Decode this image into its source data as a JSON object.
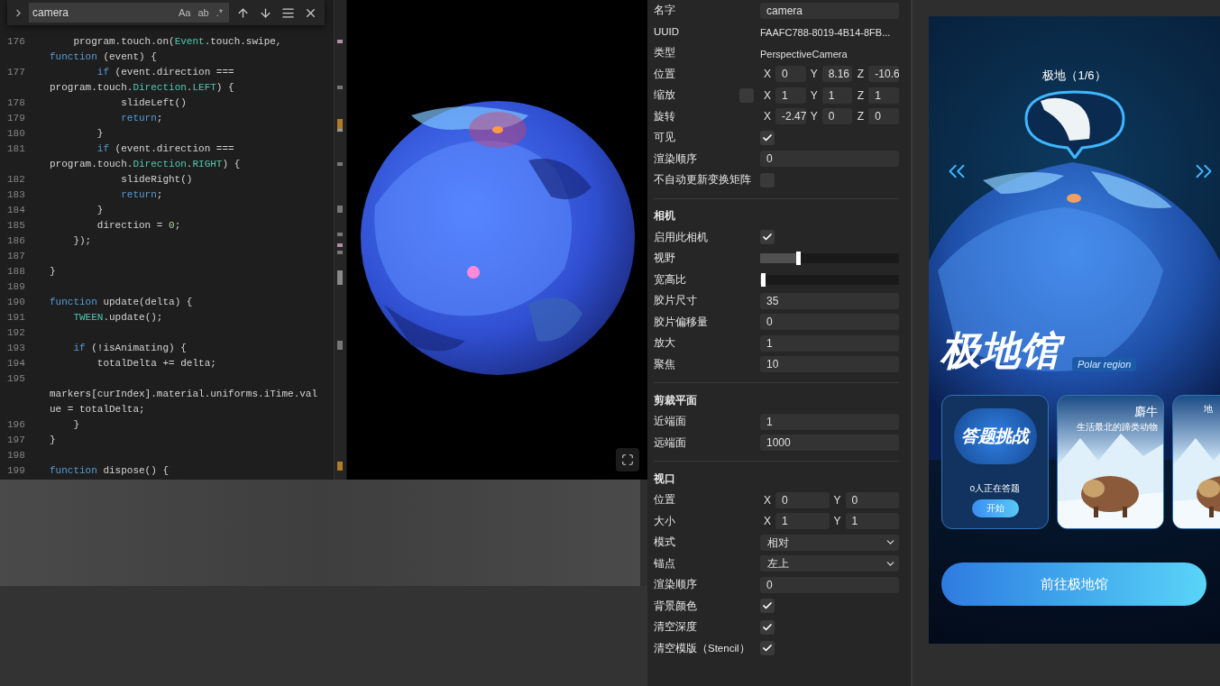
{
  "editor": {
    "search": {
      "value": "camera",
      "options": [
        {
          "label": "Aa",
          "selected": false
        },
        {
          "label": "ab",
          "selected": false
        },
        {
          "label": ".*",
          "selected": false
        }
      ]
    },
    "lines": [
      {
        "num": "176",
        "segs": [
          {
            "kind": "plain",
            "text": "    program.touch.on("
          },
          {
            "kind": "type",
            "text": "Event"
          },
          {
            "kind": "plain",
            "text": ".touch.swipe,"
          }
        ]
      },
      {
        "segs": [
          {
            "kind": "kw",
            "text": "function"
          },
          {
            "kind": "plain",
            "text": " (event) {"
          }
        ]
      },
      {
        "num": "177",
        "segs": [
          {
            "kind": "kw",
            "text": "        if"
          },
          {
            "kind": "plain",
            "text": " (event.direction ==="
          }
        ]
      },
      {
        "segs": [
          {
            "kind": "plain",
            "text": "program.touch."
          },
          {
            "kind": "type",
            "text": "Direction"
          },
          {
            "kind": "plain",
            "text": "."
          },
          {
            "kind": "type",
            "text": "LEFT"
          },
          {
            "kind": "plain",
            "text": ") {"
          }
        ]
      },
      {
        "num": "178",
        "segs": [
          {
            "kind": "plain",
            "text": "            slideLeft()"
          }
        ]
      },
      {
        "num": "179",
        "segs": [
          {
            "kind": "kw",
            "text": "            return"
          },
          {
            "kind": "plain",
            "text": ";"
          }
        ]
      },
      {
        "num": "180",
        "segs": [
          {
            "kind": "plain",
            "text": "        }"
          }
        ]
      },
      {
        "num": "181",
        "segs": [
          {
            "kind": "kw",
            "text": "        if"
          },
          {
            "kind": "plain",
            "text": " (event.direction ==="
          }
        ]
      },
      {
        "segs": [
          {
            "kind": "plain",
            "text": "program.touch."
          },
          {
            "kind": "type",
            "text": "Direction"
          },
          {
            "kind": "plain",
            "text": "."
          },
          {
            "kind": "type",
            "text": "RIGHT"
          },
          {
            "kind": "plain",
            "text": ") {"
          }
        ]
      },
      {
        "num": "182",
        "segs": [
          {
            "kind": "plain",
            "text": "            slideRight()"
          }
        ]
      },
      {
        "num": "183",
        "segs": [
          {
            "kind": "kw",
            "text": "            return"
          },
          {
            "kind": "plain",
            "text": ";"
          }
        ]
      },
      {
        "num": "184",
        "segs": [
          {
            "kind": "plain",
            "text": "        }"
          }
        ]
      },
      {
        "num": "185",
        "segs": [
          {
            "kind": "plain",
            "text": "        direction = "
          },
          {
            "kind": "num",
            "text": "0"
          },
          {
            "kind": "plain",
            "text": ";"
          }
        ]
      },
      {
        "num": "186",
        "segs": [
          {
            "kind": "plain",
            "text": "    });"
          }
        ]
      },
      {
        "num": "187"
      },
      {
        "num": "188",
        "segs": [
          {
            "kind": "plain",
            "text": "}"
          }
        ]
      },
      {
        "num": "189"
      },
      {
        "num": "190",
        "segs": [
          {
            "kind": "kw",
            "text": "function"
          },
          {
            "kind": "plain",
            "text": " update(delta) {"
          }
        ]
      },
      {
        "num": "191",
        "segs": [
          {
            "kind": "type",
            "text": "    TWEEN"
          },
          {
            "kind": "plain",
            "text": ".update();"
          }
        ]
      },
      {
        "num": "192"
      },
      {
        "num": "193",
        "segs": [
          {
            "kind": "kw",
            "text": "    if"
          },
          {
            "kind": "plain",
            "text": " (!isAnimating) {"
          }
        ]
      },
      {
        "num": "194",
        "segs": [
          {
            "kind": "plain",
            "text": "        totalDelta += delta;"
          }
        ]
      },
      {
        "num": "195"
      },
      {
        "segs": [
          {
            "kind": "plain",
            "text": "markers[curIndex].material.uniforms.iTime.val"
          }
        ]
      },
      {
        "segs": [
          {
            "kind": "plain",
            "text": "ue = totalDelta;"
          }
        ]
      },
      {
        "num": "196",
        "segs": [
          {
            "kind": "plain",
            "text": "    }"
          }
        ]
      },
      {
        "num": "197",
        "segs": [
          {
            "kind": "plain",
            "text": "}"
          }
        ]
      },
      {
        "num": "198"
      },
      {
        "num": "199",
        "segs": [
          {
            "kind": "kw",
            "text": "function"
          },
          {
            "kind": "plain",
            "text": " dispose() {"
          }
        ]
      }
    ]
  },
  "inspector": {
    "sections": [
      {
        "rows": [
          {
            "kind": "input",
            "label": "名字",
            "value": "camera"
          },
          {
            "kind": "text",
            "label": "UUID",
            "value": "FAAFC788-8019-4B14-8FB..."
          },
          {
            "kind": "text",
            "label": "类型",
            "value": "PerspectiveCamera"
          },
          {
            "kind": "vector",
            "label": "位置",
            "axes": [
              {
                "axis": "X",
                "value": "0"
              },
              {
                "axis": "Y",
                "value": "8.16"
              },
              {
                "axis": "Z",
                "value": "-10.6"
              }
            ]
          },
          {
            "kind": "vector",
            "label": "缩放",
            "linked": false,
            "axes": [
              {
                "axis": "X",
                "value": "1"
              },
              {
                "axis": "Y",
                "value": "1"
              },
              {
                "axis": "Z",
                "value": "1"
              }
            ]
          },
          {
            "kind": "vector",
            "label": "旋转",
            "axes": [
              {
                "axis": "X",
                "value": "-2.47"
              },
              {
                "axis": "Y",
                "value": "0"
              },
              {
                "axis": "Z",
                "value": "0"
              }
            ]
          },
          {
            "kind": "checkbox",
            "label": "可见",
            "checked": true
          },
          {
            "kind": "input",
            "label": "渲染顺序",
            "value": "0"
          },
          {
            "kind": "checkbox",
            "label": "不自动更新变换矩阵",
            "checked": false
          }
        ]
      },
      {
        "title": "相机",
        "rows": [
          {
            "kind": "checkbox",
            "label": "启用此相机",
            "checked": true
          },
          {
            "kind": "slider",
            "label": "视野",
            "level": 0.27
          },
          {
            "kind": "slider",
            "label": "宽高比",
            "level": 0.02
          },
          {
            "kind": "input",
            "label": "胶片尺寸",
            "value": "35"
          },
          {
            "kind": "input",
            "label": "胶片偏移量",
            "value": "0"
          },
          {
            "kind": "input",
            "label": "放大",
            "value": "1"
          },
          {
            "kind": "input",
            "label": "聚焦",
            "value": "10"
          }
        ]
      },
      {
        "title": "剪裁平面",
        "rows": [
          {
            "kind": "input",
            "label": "近端面",
            "value": "1"
          },
          {
            "kind": "input",
            "label": "远端面",
            "value": "1000"
          }
        ]
      },
      {
        "title": "视口",
        "rows": [
          {
            "kind": "vector",
            "label": "位置",
            "axes": [
              {
                "axis": "X",
                "value": "0"
              },
              {
                "axis": "Y",
                "value": "0"
              }
            ]
          },
          {
            "kind": "vector",
            "label": "大小",
            "axes": [
              {
                "axis": "X",
                "value": "1"
              },
              {
                "axis": "Y",
                "value": "1"
              }
            ]
          },
          {
            "kind": "select",
            "label": "模式",
            "value": "相对"
          },
          {
            "kind": "select",
            "label": "锚点",
            "value": "左上"
          },
          {
            "kind": "input",
            "label": "渲染顺序",
            "value": "0"
          },
          {
            "kind": "checkbox",
            "label": "背景颜色",
            "checked": true
          },
          {
            "kind": "checkbox",
            "label": "清空深度",
            "checked": true
          },
          {
            "kind": "checkbox",
            "label": "清空模版（Stencil）",
            "checked": true
          }
        ]
      }
    ]
  },
  "preview": {
    "title": "极地（1/6）",
    "heading": "极地馆",
    "subheading": "Polar region",
    "cards": [
      {
        "kind": "quiz",
        "badge": "答题挑战",
        "caption": "0人正在答题",
        "button": "开始"
      },
      {
        "kind": "animal",
        "title": "麝牛",
        "subtitle": "生活最北的蹄类动物"
      },
      {
        "kind": "animal",
        "subtitle": "地"
      }
    ],
    "action": "前往极地馆"
  }
}
